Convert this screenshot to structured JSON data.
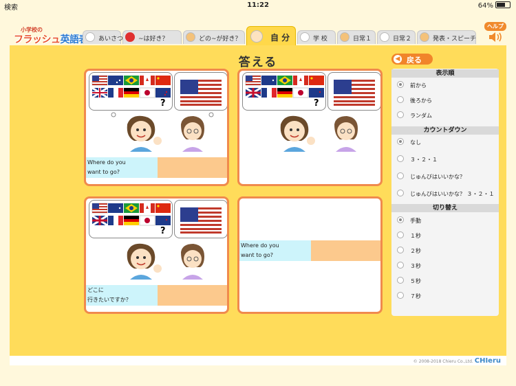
{
  "status": {
    "carrier": "検索",
    "time": "11:22",
    "battery": "64%"
  },
  "logo": {
    "small": "小学校の",
    "part1": "フラッシュ",
    "part2": "英語表現"
  },
  "tabs": [
    {
      "label": "あいさつ"
    },
    {
      "label": "~は好き？"
    },
    {
      "label": "どの~が好き？"
    },
    {
      "label": "自 分"
    },
    {
      "label": "学 校"
    },
    {
      "label": "日常１"
    },
    {
      "label": "日常２"
    },
    {
      "label": "発表・スピーチ"
    }
  ],
  "help": {
    "label": "ヘルプ"
  },
  "title": "答える",
  "back": "戻る",
  "cards": [
    {
      "question": [
        "Where do you",
        "want to go?"
      ]
    },
    {
      "question": []
    },
    {
      "question": [
        "どこに",
        "行きたいですか？"
      ]
    },
    {
      "question": [
        "Where do you",
        "want to go?"
      ]
    }
  ],
  "qmark": "?",
  "settings": {
    "order": {
      "title": "表示順",
      "options": [
        "前から",
        "後ろから",
        "ランダム"
      ],
      "selected": 0
    },
    "countdown": {
      "title": "カウントダウン",
      "options": [
        "なし",
        "３・２・１",
        "じゅんびはいいかな？",
        "じゅんびはいいかな？ ３・２・１"
      ],
      "selected": 0
    },
    "switch": {
      "title": "切り替え",
      "options": [
        "手動",
        "１秒",
        "２秒",
        "３秒",
        "５秒",
        "７秒"
      ],
      "selected": 0
    }
  },
  "footer": {
    "copyright": "© 2008-2018 Chieru Co.,Ltd.",
    "brand": "CHIeru"
  },
  "colors": {
    "main_bg": "#ffdc5a",
    "card_border": "#f08a4d",
    "question_bg": "#cdf4fb",
    "answer_bg": "#fcc98d",
    "accent": "#f1842a"
  }
}
